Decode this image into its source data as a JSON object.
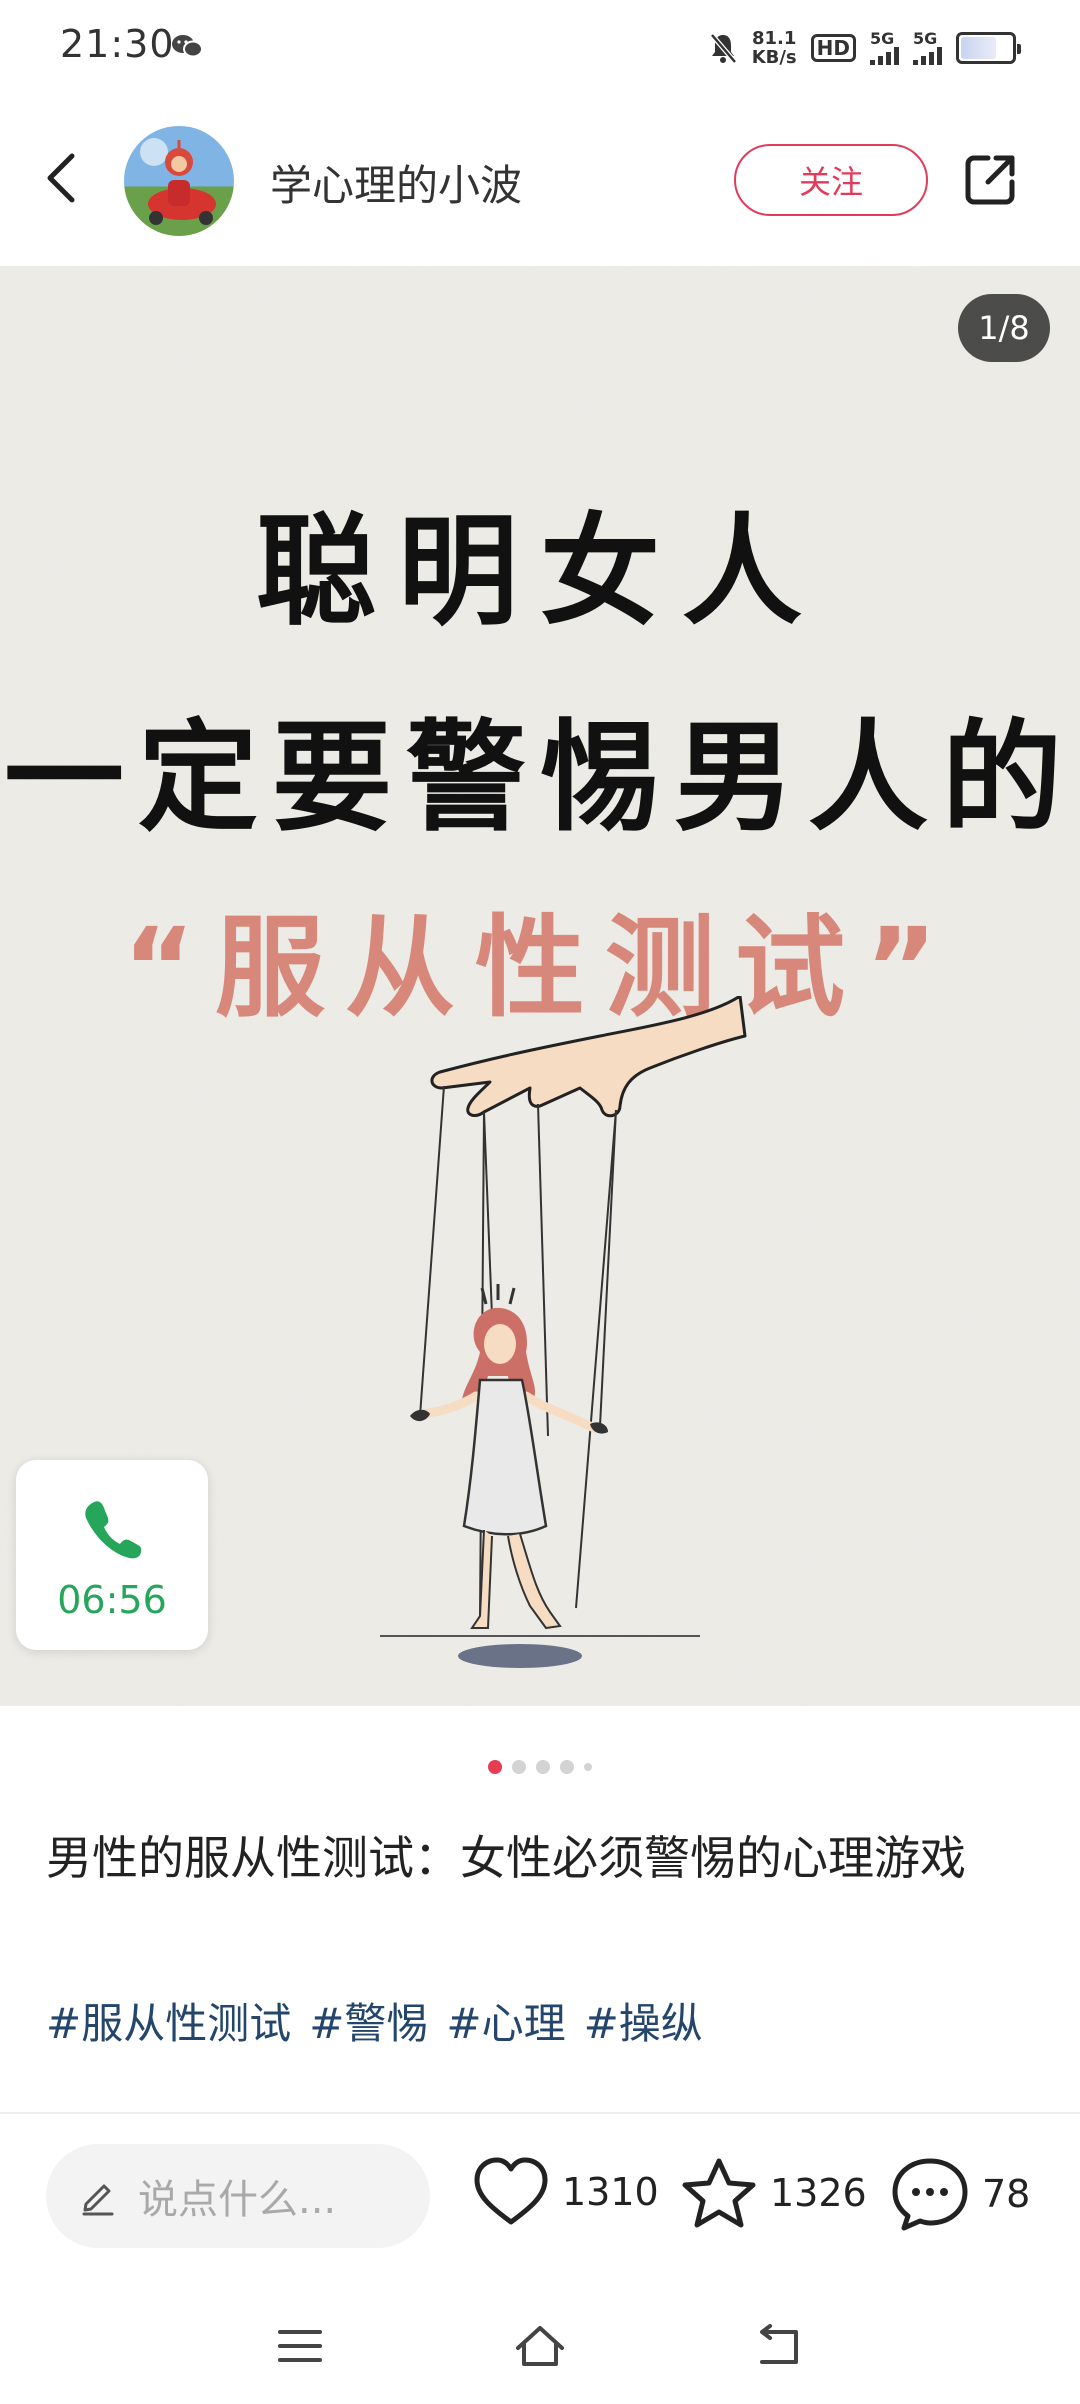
{
  "status_bar": {
    "time": "21:30",
    "net_speed_value": "81.1",
    "net_speed_unit": "KB/s",
    "hd_label": "HD",
    "sim1_label": "5G",
    "sim2_label": "5G",
    "icons": [
      "wechat-icon",
      "mute-bell-icon",
      "signal-icon",
      "battery-icon"
    ]
  },
  "header": {
    "back_icon": "chevron-left-icon",
    "author_name": "学心理的小波",
    "follow_label": "关注",
    "share_icon": "share-icon"
  },
  "post_image": {
    "page_counter": "1/8",
    "headline_line1": "聪明女人",
    "headline_line2": "一定要警惕男人的",
    "headline_line3": "“服从性测试”",
    "colors": {
      "headline": "#111111",
      "highlight": "#d8887a",
      "paper": "#efeee9"
    }
  },
  "call_widget": {
    "icon": "phone-icon",
    "duration": "06:56",
    "color": "#26a65b"
  },
  "carousel": {
    "current": 1,
    "visible_dots": 5
  },
  "post": {
    "title": "男性的服从性测试：女性必须警惕的心理游戏",
    "tags": [
      "#服从性测试",
      "#警惕",
      "#心理",
      "#操纵"
    ]
  },
  "bottom_bar": {
    "comment_placeholder": "说点什么...",
    "likes": "1310",
    "favorites": "1326",
    "comments": "78",
    "accent": "#e23b5a"
  },
  "nav_bar": {
    "icons": [
      "menu-icon",
      "home-icon",
      "back-icon"
    ]
  }
}
